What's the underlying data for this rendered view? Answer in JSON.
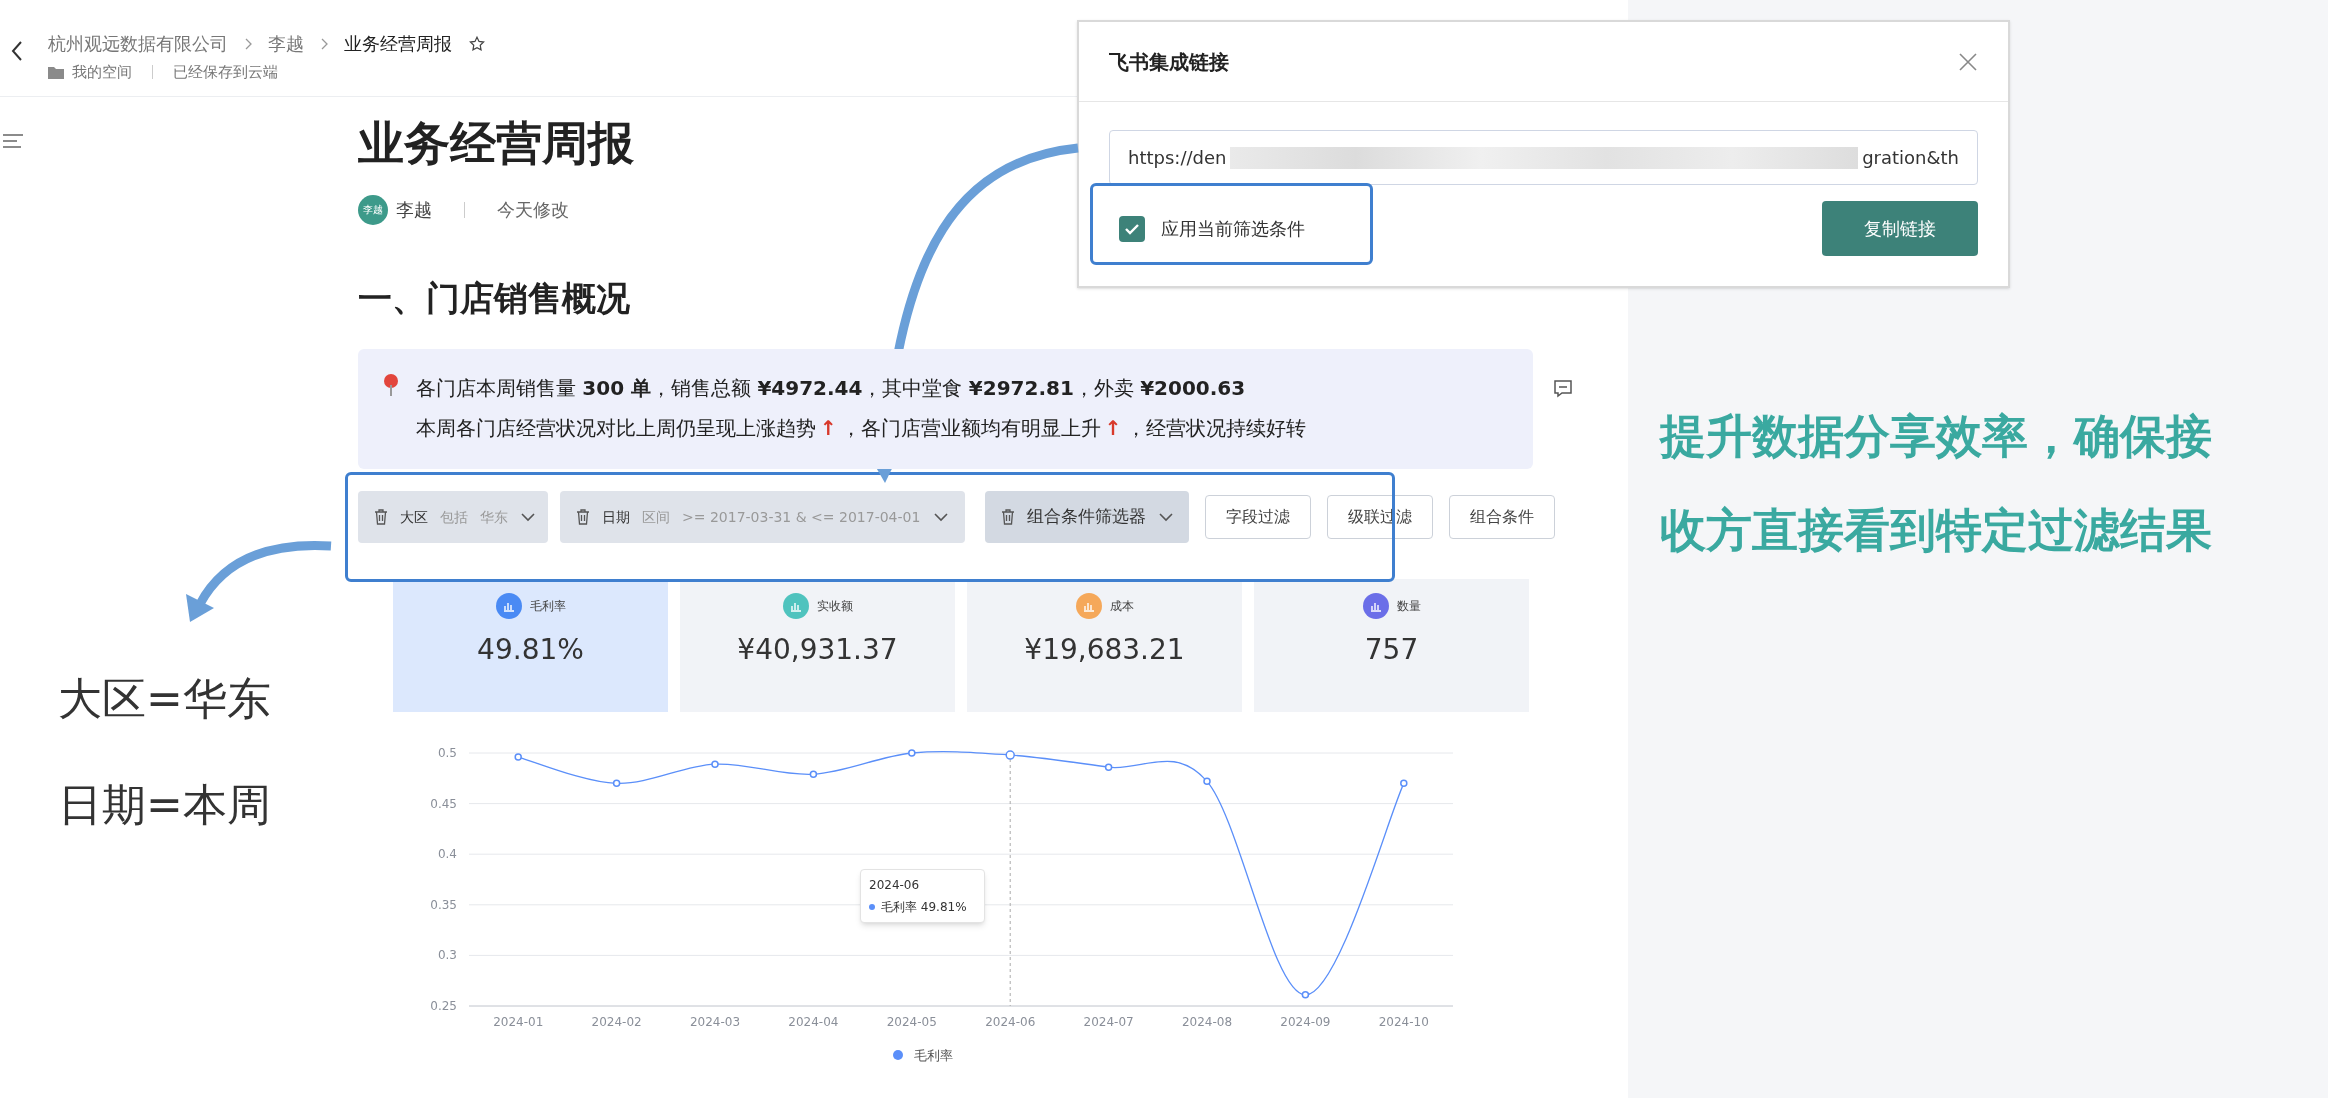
{
  "header": {
    "breadcrumb": [
      {
        "label": "杭州观远数据有限公司",
        "selected": false
      },
      {
        "label": "李越",
        "selected": false
      },
      {
        "label": "业务经营周报",
        "selected": true
      }
    ],
    "space": "我的空间",
    "save_status": "已经保存到云端"
  },
  "document": {
    "title": "业务经营周报",
    "author": {
      "avatar": "李越",
      "name": "李越"
    },
    "modified": "今天修改",
    "section_heading": "一、门店销售概况",
    "summary": {
      "line_1": "各门店本周销售量 **300 单**，销售总额 **¥4972.44**，其中堂食 **¥2972.81**，外卖 **¥2000.63**",
      "line_2": [
        {
          "kind": "text",
          "text": "本周各门店经营状况对比上周仍呈现上涨趋势"
        },
        {
          "kind": "arrow",
          "text": "↑"
        },
        {
          "kind": "text",
          "text": "，各门店营业额均有明显上升"
        },
        {
          "kind": "arrow",
          "text": "↑"
        },
        {
          "kind": "text",
          "text": "，经营状况持续好转"
        }
      ]
    },
    "filters": [
      {
        "kind": "chip",
        "field": "大区",
        "operator": "包括",
        "value": "华东"
      },
      {
        "kind": "chip",
        "field": "日期",
        "operator": "区间",
        "value": ">= 2017-03-31 & <= 2017-04-01"
      },
      {
        "kind": "combo",
        "field": "组合条件筛选器"
      },
      {
        "kind": "button",
        "field": "字段过滤"
      },
      {
        "kind": "button",
        "field": "级联过滤"
      },
      {
        "kind": "button",
        "field": "组合条件"
      }
    ],
    "metrics": [
      {
        "label": "毛利率",
        "value": "49.81%",
        "color": "#4a8af4",
        "selected": true
      },
      {
        "label": "实收额",
        "value": "¥40,931.37",
        "color": "#4fc3be",
        "selected": false
      },
      {
        "label": "成本",
        "value": "¥19,683.21",
        "color": "#f5a85a",
        "selected": false
      },
      {
        "label": "数量",
        "value": "757",
        "color": "#6b6ee8",
        "selected": false
      }
    ],
    "chart": {
      "tooltip": {
        "title": "2024-06",
        "label": "毛利率 49.81%"
      },
      "chart_data": {
        "type": "line",
        "grid": true,
        "ref_lines": [
          {
            "axis": "x",
            "value": "2024-06"
          }
        ],
        "categories": [
          "2024-01",
          "2024-02",
          "2024-03",
          "2024-04",
          "2024-05",
          "2024-06",
          "2024-07",
          "2024-08",
          "2024-09",
          "2024-10"
        ],
        "ylim": [
          0.25,
          0.5
        ],
        "yticks": [
          0.25,
          0.3,
          0.35,
          0.4,
          0.45,
          0.5
        ],
        "series": [
          {
            "name": "毛利率",
            "color": "#5b8ff9",
            "marker": true,
            "values": [
              0.496,
              0.47,
              0.489,
              0.479,
              0.5,
              0.498,
              0.486,
              0.472,
              0.261,
              0.47
            ]
          }
        ]
      }
    }
  },
  "dialog": {
    "title": "飞书集成链接",
    "url_start": "https://den",
    "url_end": "gration&th",
    "apply_filters": {
      "label": "应用当前筛选条件",
      "checked": true
    },
    "copy_button": "复制链接"
  },
  "annotations": {
    "filter_notes": [
      "大区=华东",
      "日期=本周"
    ],
    "caption": [
      "提升数据分享效率，确保接",
      "收方直接看到特定过滤结果"
    ]
  }
}
